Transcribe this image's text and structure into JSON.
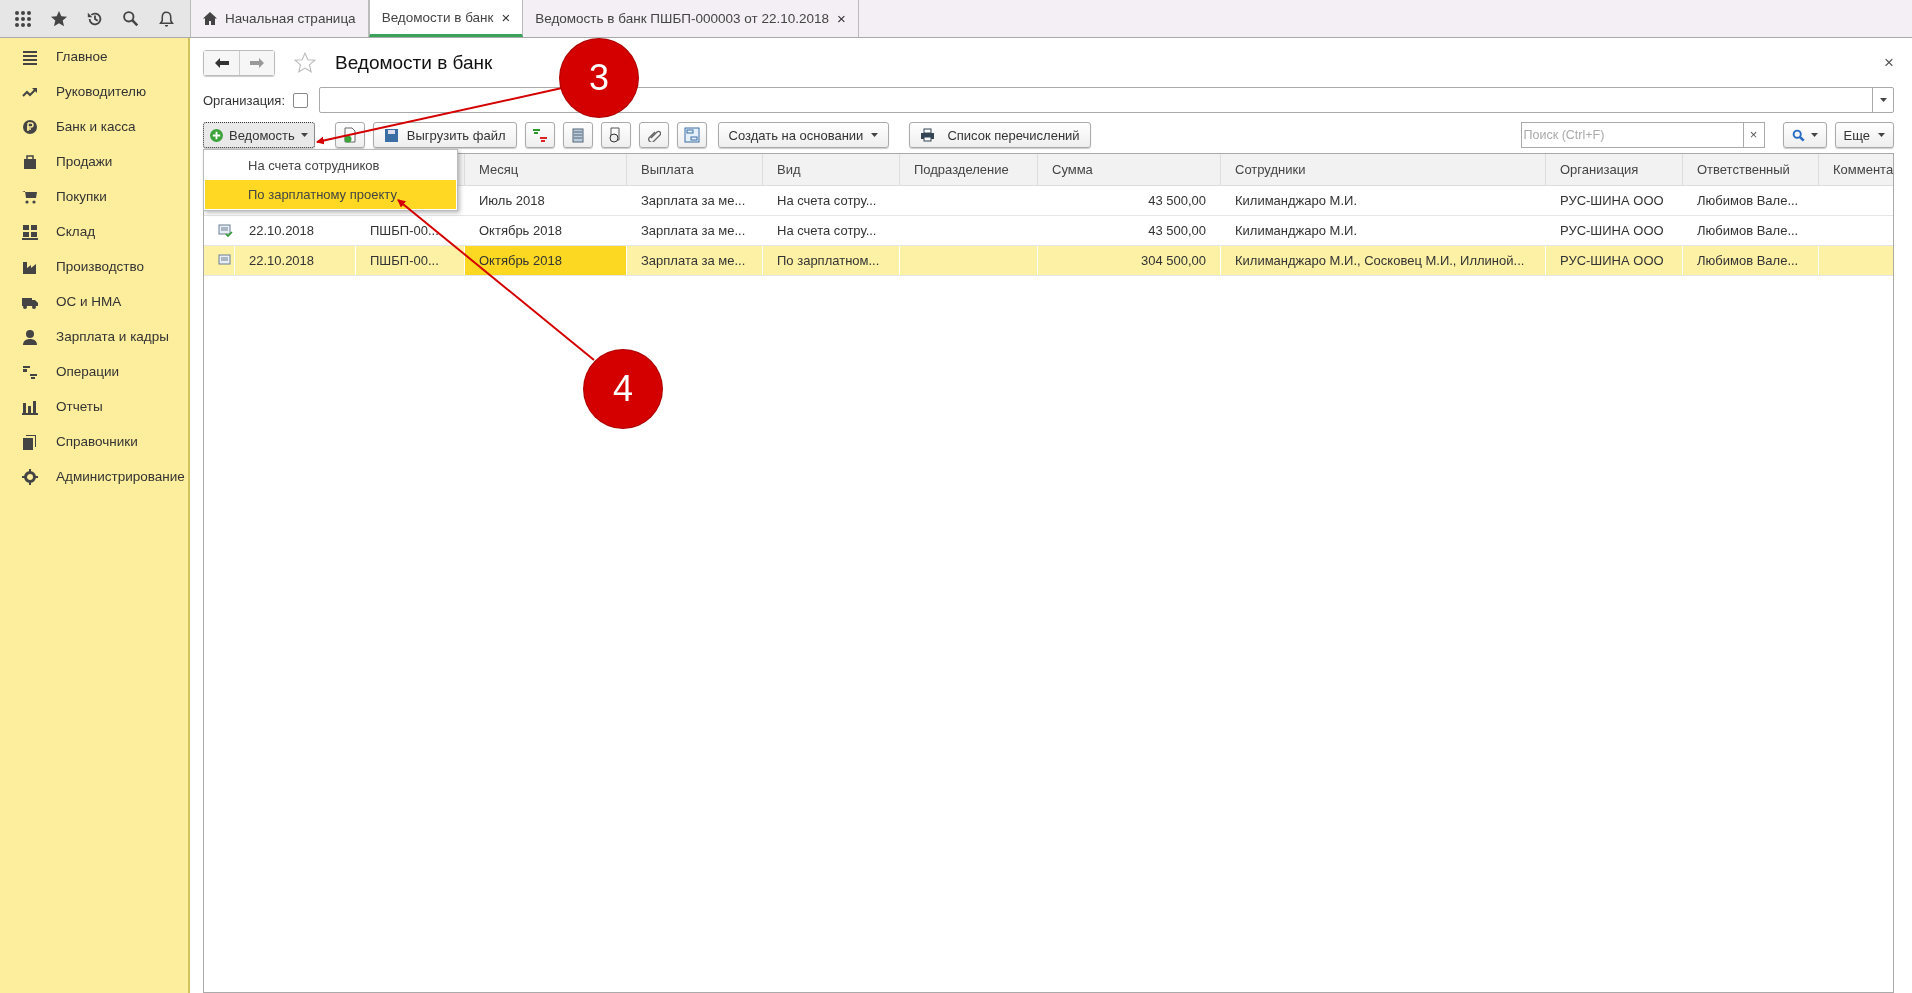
{
  "top_bar": {
    "tabs": [
      {
        "label": "Начальная страница",
        "selected": false,
        "kind": "home"
      },
      {
        "label": "Ведомости в банк",
        "selected": true,
        "kind": "page",
        "close": "×"
      },
      {
        "label": "Ведомость в банк ПШБП-000003 от 22.10.2018",
        "selected": false,
        "kind": "page",
        "close": "×"
      }
    ]
  },
  "sidebar": {
    "items": [
      {
        "label": "Главное"
      },
      {
        "label": "Руководителю"
      },
      {
        "label": "Банк и касса"
      },
      {
        "label": "Продажи"
      },
      {
        "label": "Покупки"
      },
      {
        "label": "Склад"
      },
      {
        "label": "Производство"
      },
      {
        "label": "ОС и НМА"
      },
      {
        "label": "Зарплата и кадры"
      },
      {
        "label": "Операции"
      },
      {
        "label": "Отчеты"
      },
      {
        "label": "Справочники"
      },
      {
        "label": "Администрирование"
      }
    ]
  },
  "page": {
    "title": "Ведомости в банк",
    "close": "×",
    "favorite": false,
    "filter": {
      "label": "Организация:",
      "checked": false
    },
    "toolbar": {
      "create": "Ведомость",
      "export": "Выгрузить файл",
      "based_on": "Создать на основании",
      "payments_list": "Список перечислений",
      "search": {
        "placeholder": "Поиск (Ctrl+F)",
        "clear": "×"
      },
      "more": "Еще"
    },
    "dropdown": {
      "items": [
        {
          "label": "На счета сотрудников",
          "selected": false
        },
        {
          "label": "По зарплатному проекту",
          "selected": true
        }
      ]
    },
    "table": {
      "columns": [
        "Месяц",
        "Выплата",
        "Вид",
        "Подразделение",
        "Сумма",
        "Сотрудники",
        "Организация",
        "Ответственный",
        "Коммента"
      ],
      "rows": [
        {
          "selected": false,
          "month": "Июль 2018",
          "payout": "Зарплата за ме...",
          "type": "На счета сотру...",
          "amount": "43 500,00",
          "employees": "Килиманджаро М.И.",
          "organization": "РУС-ШИНА ООО",
          "responsible": "Любимов Вале..."
        },
        {
          "selected": false,
          "posted": true,
          "date": "22.10.2018",
          "number": "ПШБП-00...",
          "month": "Октябрь 2018",
          "payout": "Зарплата за ме...",
          "type": "На счета сотру...",
          "amount": "43 500,00",
          "employees": "Килиманджаро М.И.",
          "organization": "РУС-ШИНА ООО",
          "responsible": "Любимов Вале..."
        },
        {
          "selected": true,
          "posted": false,
          "date": "22.10.2018",
          "number": "ПШБП-00...",
          "month": "Октябрь 2018",
          "payout": "Зарплата за ме...",
          "type": "По зарплатном...",
          "amount": "304 500,00",
          "employees": "Килиманджаро М.И., Сосковец М.И., Иллиной...",
          "organization": "РУС-ШИНА ООО",
          "responsible": "Любимов Вале..."
        }
      ]
    }
  },
  "callouts": [
    {
      "number": "3"
    },
    {
      "number": "4"
    }
  ]
}
